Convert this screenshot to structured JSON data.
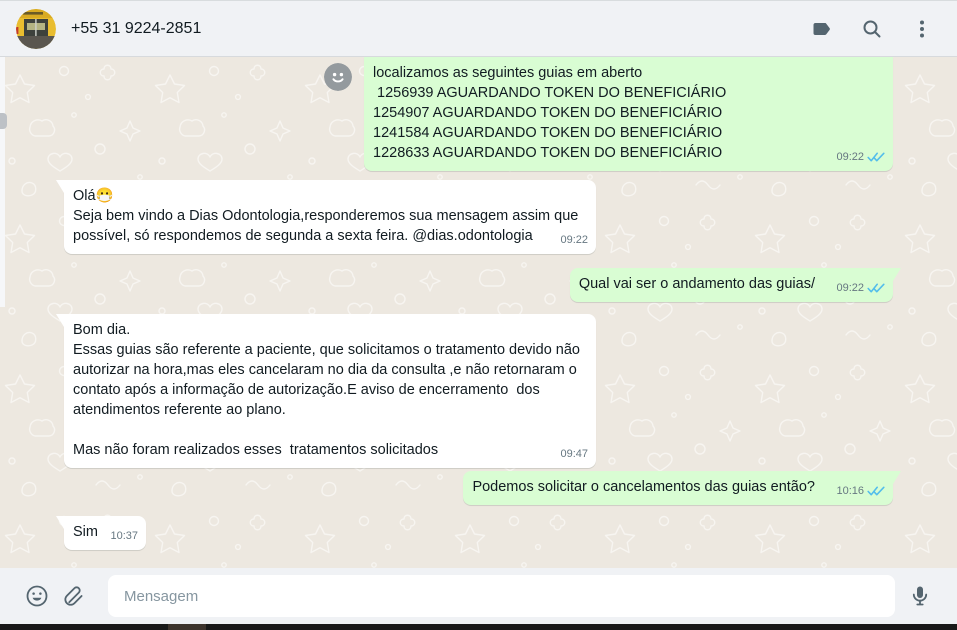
{
  "header": {
    "contact": "+55 31 9224-2851"
  },
  "chat": {
    "messages": [
      {
        "direction": "out",
        "text": "localizamos as seguintes guias em aberto\n 1256939 AGUARDANDO TOKEN DO BENEFICIÁRIO\n1254907 AGUARDANDO TOKEN DO BENEFICIÁRIO\n1241584 AGUARDANDO TOKEN DO BENEFICIÁRIO\n1228633 AGUARDANDO TOKEN DO BENEFICIÁRIO",
        "time": "09:22",
        "status": "read",
        "has_avatar": true,
        "tail": "none"
      },
      {
        "direction": "in",
        "text": "Olá😷\nSeja bem vindo a Dias Odontologia,responderemos sua mensagem assim que possível, só respondemos de segunda a sexta feira. @dias.odontologia",
        "time": "09:22",
        "tail": "left"
      },
      {
        "direction": "out",
        "text": "Qual vai ser o andamento das guias/",
        "time": "09:22",
        "status": "read",
        "tail": "right"
      },
      {
        "direction": "in",
        "text": "Bom dia.\nEssas guias são referente a paciente, que solicitamos o tratamento devido não autorizar na hora,mas eles cancelaram no dia da consulta ,e não retornaram o contato após a informação de autorização.E aviso de encerramento  dos atendimentos referente ao plano.\n\nMas não foram realizados esses  tratamentos solicitados",
        "time": "09:47",
        "tail": "left"
      },
      {
        "direction": "out",
        "text": "Podemos solicitar o cancelamentos das guias então?",
        "time": "10:16",
        "status": "read",
        "tail": "right"
      },
      {
        "direction": "in",
        "text": "Sim",
        "time": "10:37",
        "tail": "left"
      }
    ]
  },
  "composer": {
    "placeholder": "Mensagem"
  },
  "icons": {
    "header": [
      "label-icon",
      "search-icon",
      "kebab-menu-icon"
    ],
    "composer": [
      "emoji-icon",
      "attachment-icon",
      "microphone-icon"
    ],
    "message": [
      "double-check-icon",
      "default-avatar-icon"
    ]
  },
  "colors": {
    "header_bar": "#f0f2f5",
    "chat_background": "#ede8e0",
    "outgoing_bubble": "#d9fdd3",
    "incoming_bubble": "#ffffff",
    "read_tick": "#53bdeb",
    "icon": "#54656f",
    "timestamp": "#667781",
    "text": "#111b21",
    "placeholder": "#8696a0"
  }
}
